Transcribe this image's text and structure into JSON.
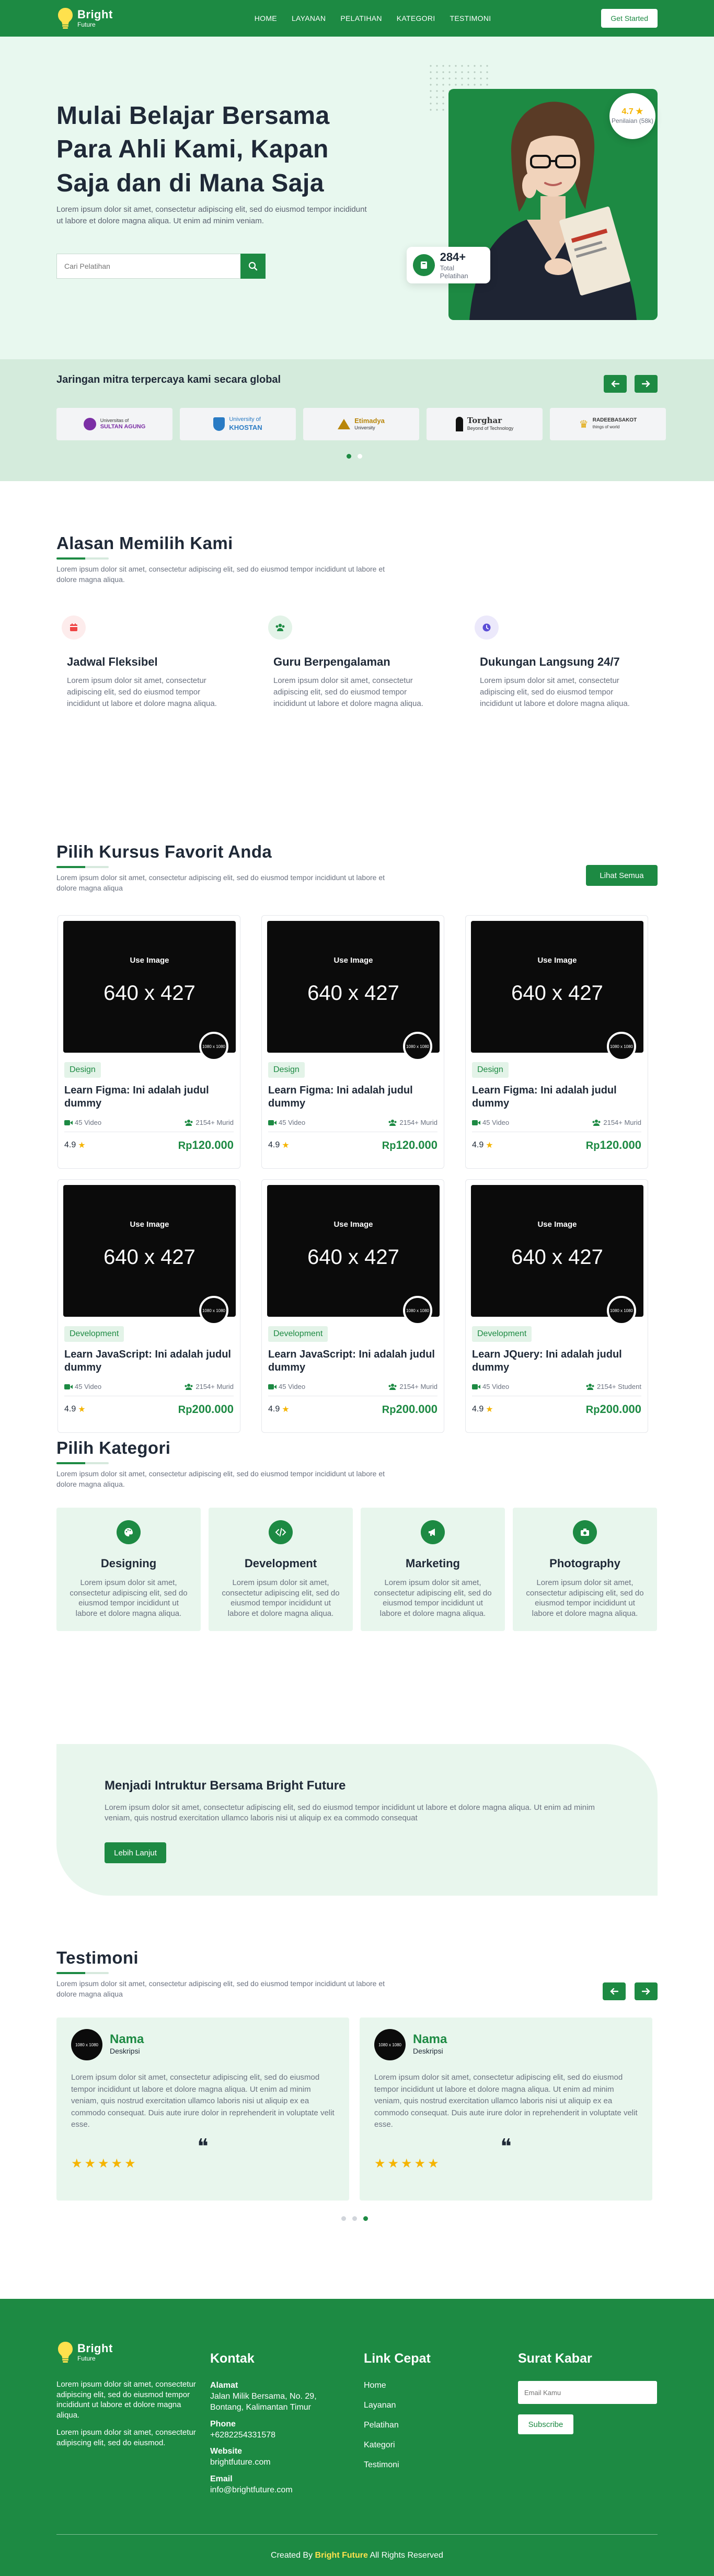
{
  "brand": {
    "name": "Bright",
    "tagline": "Future"
  },
  "nav": {
    "items": [
      "HOME",
      "LAYANAN",
      "PELATIHAN",
      "KATEGORI",
      "TESTIMONI"
    ],
    "cta": "Get Started"
  },
  "hero": {
    "title": "Mulai Belajar Bersama Para Ahli Kami, Kapan Saja dan di Mana Saja",
    "description": "Lorem ipsum dolor sit amet, consectetur adipiscing elit, sed do eiusmod tempor incididunt ut labore et dolore magna aliqua. Ut enim ad minim veniam.",
    "search_placeholder": "Cari Pelatihan",
    "rating": {
      "value": "4.7",
      "label": "Penilaian (58k)"
    },
    "stat": {
      "value": "284+",
      "label": "Total Pelatihan"
    }
  },
  "partners": {
    "title": "Jaringan mitra terpercaya kami secara global",
    "logos": [
      {
        "name": "Universitas Islam Sultan Agung",
        "short": "Universitas of",
        "line2": "SULTAN AGUNG",
        "color": "#7b2fa5"
      },
      {
        "name": "University of Khostan",
        "short": "University of",
        "line2": "KHOSTAN",
        "color": "#2a7bc4"
      },
      {
        "name": "Etimadya University",
        "short": "Etimadya",
        "line2": "University",
        "color": "#b8860b"
      },
      {
        "name": "Torghar Beyond of Technology",
        "short": "Torghar",
        "line2": "Beyond of Technology",
        "color": "#111111"
      },
      {
        "name": "Radeebasakot",
        "short": "RADEEBASAKOT",
        "line2": "things of world",
        "color": "#e0a400"
      }
    ]
  },
  "reasons": {
    "title": "Alasan Memilih Kami",
    "description": "Lorem ipsum dolor sit amet, consectetur adipiscing elit, sed do eiusmod tempor incididunt ut labore et dolore magna aliqua.",
    "items": [
      {
        "title": "Jadwal Fleksibel",
        "text": "Lorem ipsum dolor sit amet, consectetur adipiscing elit, sed do eiusmod tempor incididunt ut labore et dolore magna aliqua.",
        "icon": "calendar-icon",
        "color": "#ef4444",
        "bg": "#fdecec"
      },
      {
        "title": "Guru Berpengalaman",
        "text": "Lorem ipsum dolor sit amet, consectetur adipiscing elit, sed do eiusmod tempor incididunt ut labore et dolore magna aliqua.",
        "icon": "users-icon",
        "color": "#1d8a43",
        "bg": "#e3f3e8"
      },
      {
        "title": "Dukungan Langsung 24/7",
        "text": "Lorem ipsum dolor sit amet, consectetur adipiscing elit, sed do eiusmod tempor incididunt ut labore et dolore magna aliqua.",
        "icon": "clock-icon",
        "color": "#5b4dd6",
        "bg": "#ece9fb"
      }
    ]
  },
  "courses": {
    "title": "Pilih Kursus Favorit Anda",
    "description": "Lorem ipsum dolor sit amet, consectetur adipiscing elit, sed do eiusmod tempor incididunt ut labore et dolore magna aliqua",
    "see_all": "Lihat Semua",
    "image_label": "Use Image",
    "image_dims": "640 x 427",
    "avatar_label": "1080 x 1080",
    "items": [
      {
        "tag": "Design",
        "title": "Learn Figma: Ini adalah judul dummy",
        "videos": "45 Video",
        "students": "2154+ Murid",
        "rating": "4.9",
        "currency": "Rp",
        "price": "120.000"
      },
      {
        "tag": "Design",
        "title": "Learn Figma: Ini adalah judul dummy",
        "videos": "45 Video",
        "students": "2154+ Murid",
        "rating": "4.9",
        "currency": "Rp",
        "price": "120.000"
      },
      {
        "tag": "Design",
        "title": "Learn Figma: Ini adalah judul dummy",
        "videos": "45 Video",
        "students": "2154+ Murid",
        "rating": "4.9",
        "currency": "Rp",
        "price": "120.000"
      },
      {
        "tag": "Development",
        "title": "Learn JavaScript: Ini adalah judul dummy",
        "videos": "45 Video",
        "students": "2154+ Murid",
        "rating": "4.9",
        "currency": "Rp",
        "price": "200.000"
      },
      {
        "tag": "Development",
        "title": "Learn JavaScript: Ini adalah judul dummy",
        "videos": "45 Video",
        "students": "2154+ Murid",
        "rating": "4.9",
        "currency": "Rp",
        "price": "200.000"
      },
      {
        "tag": "Development",
        "title": "Learn JQuery: Ini adalah judul dummy",
        "videos": "45 Video",
        "students": "2154+ Student",
        "rating": "4.9",
        "currency": "Rp",
        "price": "200.000"
      }
    ]
  },
  "categories": {
    "title": "Pilih Kategori",
    "description": "Lorem ipsum dolor sit amet, consectetur adipiscing elit, sed do eiusmod tempor incididunt ut labore et dolore magna aliqua.",
    "items": [
      {
        "title": "Designing",
        "text": "Lorem ipsum dolor sit amet, consectetur adipiscing elit, sed do eiusmod tempor incididunt ut labore et dolore magna aliqua.",
        "icon": "palette-icon"
      },
      {
        "title": "Development",
        "text": "Lorem ipsum dolor sit amet, consectetur adipiscing elit, sed do eiusmod tempor incididunt ut labore et dolore magna aliqua.",
        "icon": "code-icon"
      },
      {
        "title": "Marketing",
        "text": "Lorem ipsum dolor sit amet, consectetur adipiscing elit, sed do eiusmod tempor incididunt ut labore et dolore magna aliqua.",
        "icon": "megaphone-icon"
      },
      {
        "title": "Photography",
        "text": "Lorem ipsum dolor sit amet, consectetur adipiscing elit, sed do eiusmod tempor incididunt ut labore et dolore magna aliqua.",
        "icon": "camera-icon"
      }
    ]
  },
  "instructor": {
    "title": "Menjadi Intruktur Bersama Bright Future",
    "text": "Lorem ipsum dolor sit amet, consectetur adipiscing elit, sed do eiusmod tempor incididunt ut labore et dolore magna aliqua. Ut enim ad minim veniam, quis nostrud exercitation ullamco laboris nisi ut aliquip ex ea commodo consequat",
    "button": "Lebih Lanjut"
  },
  "testimonials": {
    "title": "Testimoni",
    "description": "Lorem ipsum dolor sit amet, consectetur adipiscing elit, sed do eiusmod tempor incididunt ut labore et dolore magna aliqua",
    "photo_label": "1080 x 1080",
    "quote_mark": "❝",
    "items": [
      {
        "name": "Nama",
        "role": "Deskripsi",
        "text": "Lorem ipsum dolor sit amet, consectetur adipiscing elit, sed do eiusmod tempor incididunt ut labore et dolore magna aliqua. Ut enim ad minim veniam, quis nostrud exercitation ullamco laboris nisi ut aliquip ex ea commodo consequat. Duis aute irure dolor in reprehenderit in voluptate velit esse.",
        "stars": "★★★★★"
      },
      {
        "name": "Nama",
        "role": "Deskripsi",
        "text": "Lorem ipsum dolor sit amet, consectetur adipiscing elit, sed do eiusmod tempor incididunt ut labore et dolore magna aliqua. Ut enim ad minim veniam, quis nostrud exercitation ullamco laboris nisi ut aliquip ex ea commodo consequat. Duis aute irure dolor in reprehenderit in voluptate velit esse.",
        "stars": "★★★★★"
      }
    ]
  },
  "footer": {
    "about_1": "Lorem ipsum dolor sit amet, consectetur adipiscing elit, sed do eiusmod tempor incididunt ut labore et dolore magna aliqua.",
    "about_2": "Lorem ipsum dolor sit amet, consectetur adipiscing elit, sed do eiusmod.",
    "contact_title": "Kontak",
    "address_label": "Alamat",
    "address": "Jalan Milik Bersama, No. 29, Bontang, Kalimantan Timur",
    "phone_label": "Phone",
    "phone": "+6282254331578",
    "website_label": "Website",
    "website": "brightfuture.com",
    "email_label": "Email",
    "email": "info@brightfuture.com",
    "links_title": "Link Cepat",
    "links": [
      "Home",
      "Layanan",
      "Pelatihan",
      "Kategori",
      "Testimoni"
    ],
    "newsletter_title": "Surat Kabar",
    "newsletter_placeholder": "Email Kamu",
    "subscribe": "Subscribe",
    "copyright_prefix": "Created By",
    "copyright_brand": "Bright Future",
    "copyright_suffix": "All Rights Reserved"
  }
}
